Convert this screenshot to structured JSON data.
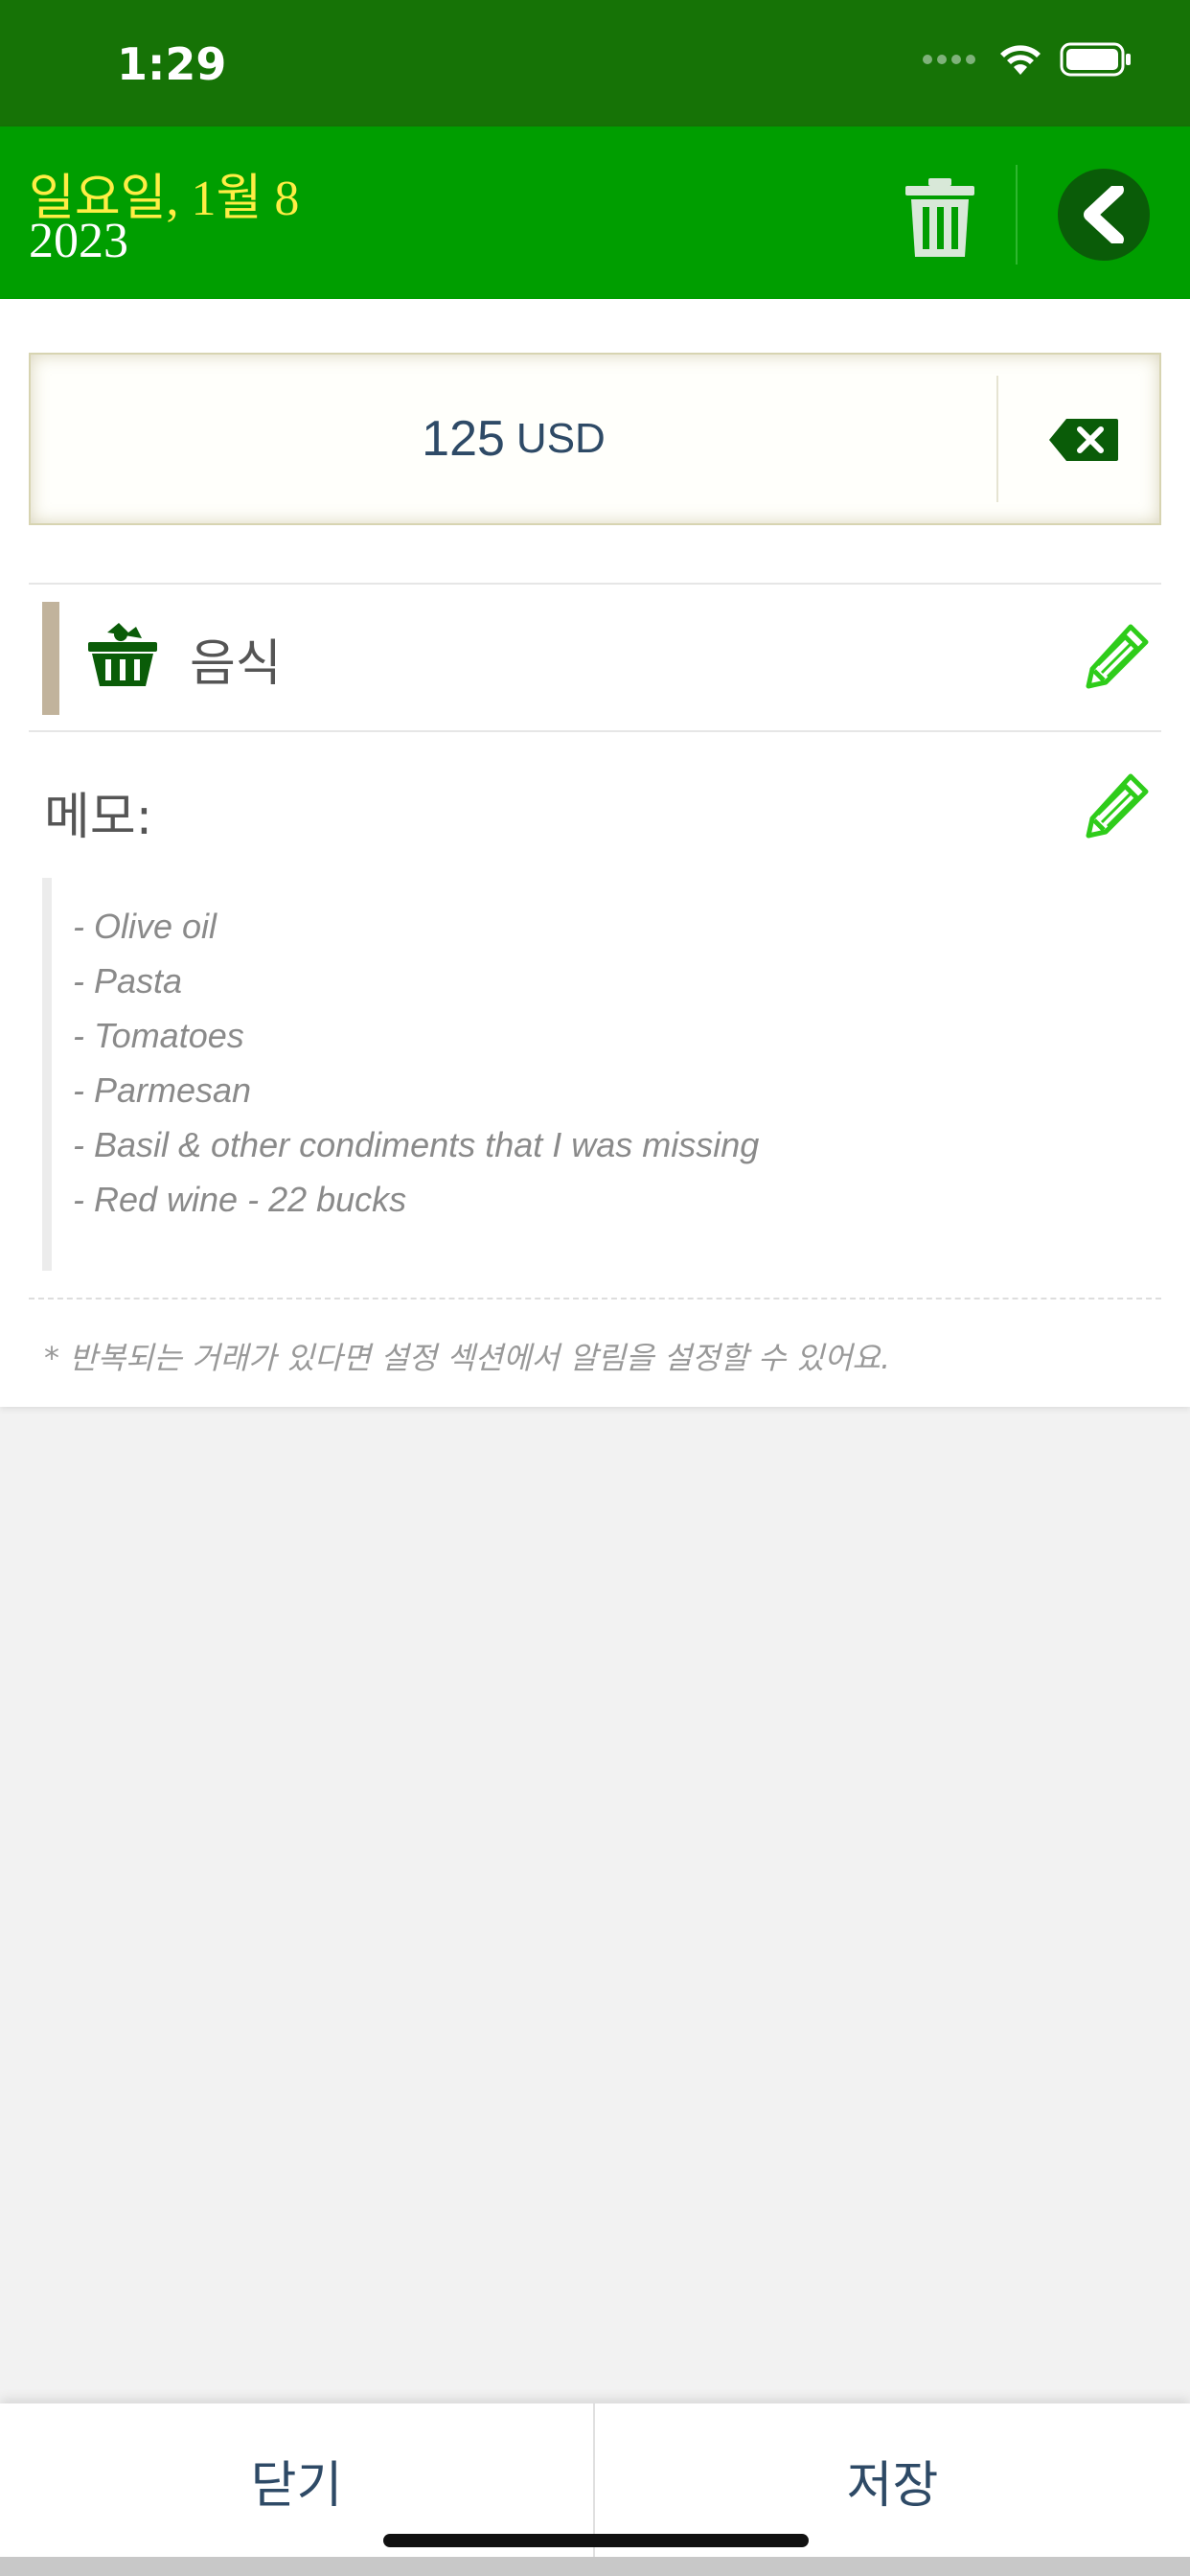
{
  "status_bar": {
    "time": "1:29"
  },
  "header": {
    "date": "일요일, 1월 8",
    "year": "2023"
  },
  "amount": {
    "value": "125",
    "currency": "USD"
  },
  "category": {
    "label": "음식"
  },
  "memo": {
    "label": "메모:",
    "lines": [
      "- Olive oil",
      "- Pasta",
      "- Tomatoes",
      "- Parmesan",
      "- Basil & other condiments that I was missing",
      "- Red wine - 22 bucks"
    ]
  },
  "footnote": "* 반복되는 거래가 있다면 설정 섹션에서 알림을 설정할 수 있어요.",
  "bottom": {
    "close_label": "닫기",
    "save_label": "저장"
  },
  "colors": {
    "status_bar": "#167306",
    "header": "#009e00",
    "date_text": "#ffee44",
    "pencil": "#2ecc1a",
    "category_bar": "#c1b39c"
  }
}
